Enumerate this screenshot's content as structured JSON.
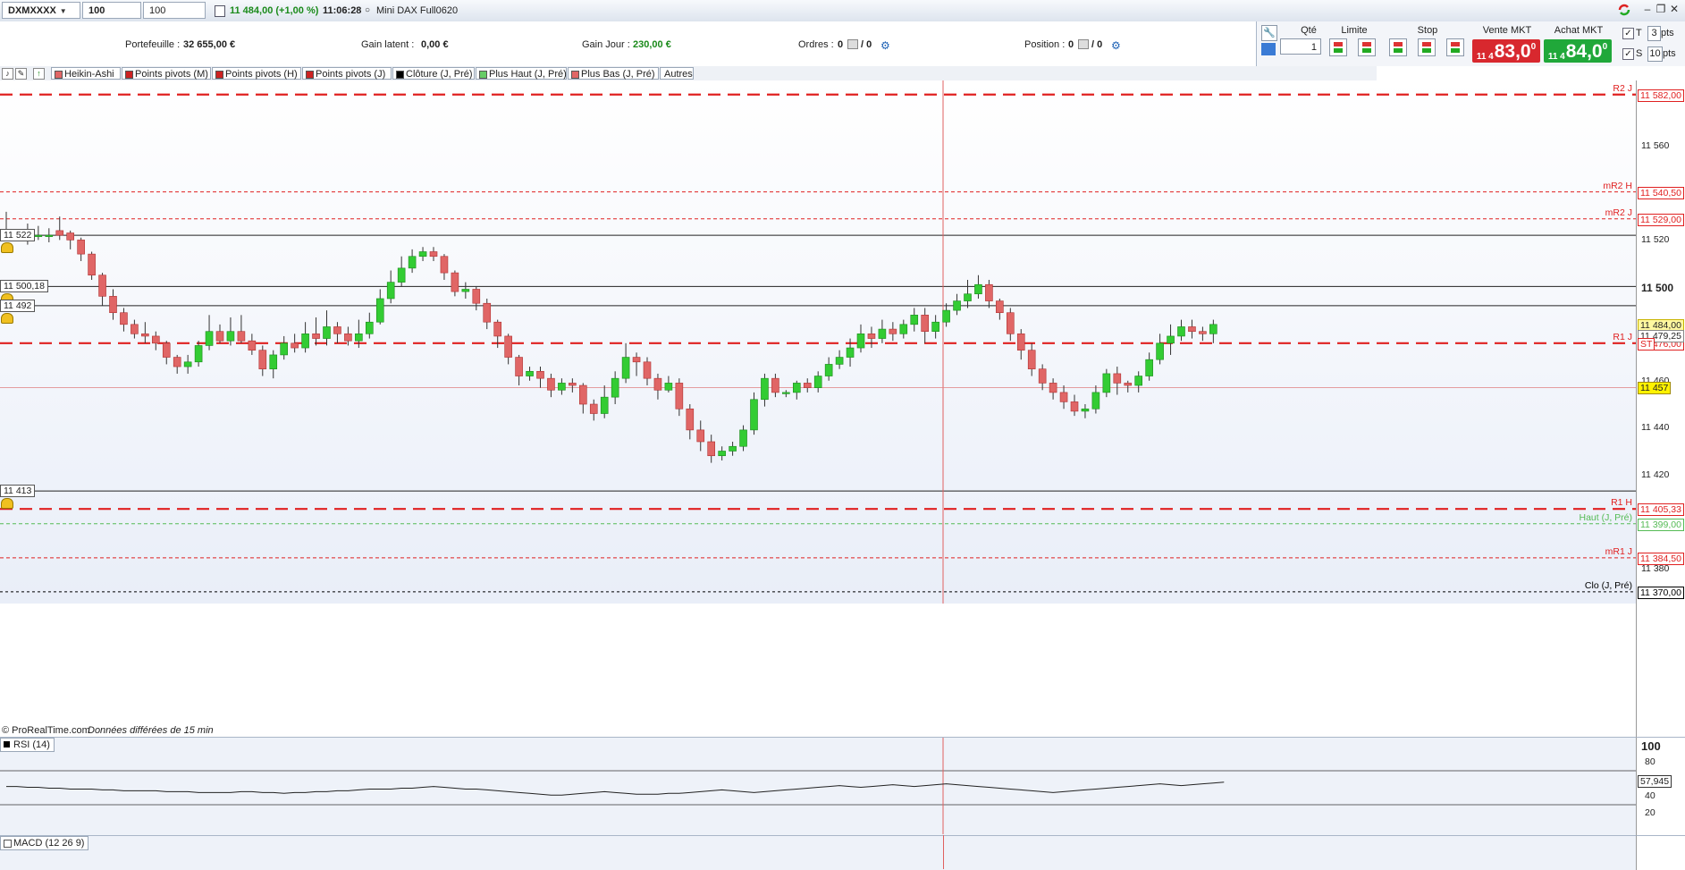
{
  "toolbar": {
    "instrument": "DXMXXXX",
    "interval": "100 ticks",
    "units": "100 unités",
    "price": "11 484,00 (+1,00 %)",
    "time": "11:06:28",
    "name": "Mini DAX Full0620"
  },
  "stats": {
    "portefeuille_label": "Portefeuille :",
    "portefeuille_value": "32 655,00 €",
    "gain_latent_label": "Gain latent :",
    "gain_latent_value": "0,00 €",
    "gain_jour_label": "Gain Jour :",
    "gain_jour_value": "230,00 €",
    "ordres_label": "Ordres :",
    "ordres_a": "0",
    "ordres_b": "/ 0",
    "position_label": "Position :",
    "position_a": "0",
    "position_b": "/ 0"
  },
  "order_panel": {
    "qty_label": "Qté",
    "qty_value": "1",
    "limit_label": "Limite",
    "stop_label": "Stop",
    "sell_label": "Vente MKT",
    "buy_label": "Achat MKT",
    "sell_small": "11 4",
    "sell_big": "83,0",
    "sell_sup": "0",
    "buy_small": "11 4",
    "buy_big": "84,0",
    "buy_sup": "0",
    "t_label": "T",
    "t_value": "3",
    "t_unit": "pts",
    "s_label": "S",
    "s_value": "10",
    "s_unit": "pts"
  },
  "indicators": [
    {
      "label": "Heikin-Ashi",
      "color": "#e06666"
    },
    {
      "label": "Points pivots (M)",
      "color": "#cc2222"
    },
    {
      "label": "Points pivots (H)",
      "color": "#cc2222"
    },
    {
      "label": "Points pivots (J)",
      "color": "#cc2222"
    },
    {
      "label": "Clôture (J, Pré)",
      "color": "#000000"
    },
    {
      "label": "Plus Haut (J, Pré)",
      "color": "#66cc66"
    },
    {
      "label": "Plus Bas (J, Pré)",
      "color": "#e06666"
    },
    {
      "label": "Autres",
      "color": ""
    }
  ],
  "chart_data": {
    "type": "candlestick",
    "ylim": [
      11365,
      11588
    ],
    "y_ticks": [
      "11 560",
      "11 520",
      "11 500",
      "11 460",
      "11 440",
      "11 420",
      "11 380"
    ],
    "levels": [
      {
        "name": "R2 J",
        "value": "11 582,00",
        "color": "#e02020"
      },
      {
        "name": "mR2 H",
        "value": "11 540,50",
        "color": "#e02020"
      },
      {
        "name": "mR2 J",
        "value": "11 529,00",
        "color": "#e02020"
      },
      {
        "name": "R1 J",
        "value": "11 476,00",
        "color": "#e02020"
      },
      {
        "name": "R1 H",
        "value": "11 405,33",
        "color": "#e02020"
      },
      {
        "name": "Haut (J, Pré)",
        "value": "11 399,00",
        "color": "#55bb55"
      },
      {
        "name": "mR1 J",
        "value": "11 384,50",
        "color": "#e02020"
      },
      {
        "name": "Clo (J, Pré)",
        "value": "11 370,00",
        "color": "#000000"
      }
    ],
    "price_tags": {
      "last": "11 484,00",
      "mid": "11 479,25",
      "st": "ST",
      "cursor": "11 457"
    },
    "alert_lines": [
      "11 522",
      "11 500,18",
      "11 492",
      "11 413"
    ],
    "candles": [
      [
        11523,
        11523,
        11523,
        11532
      ],
      [
        11522,
        11522,
        11522,
        11523
      ],
      [
        11521,
        11523,
        11518,
        11527
      ],
      [
        11522,
        11522,
        11520,
        11526
      ],
      [
        11522,
        11522,
        11519,
        11525
      ],
      [
        11524,
        11522,
        11520,
        11530
      ],
      [
        11523,
        11520,
        11516,
        11524
      ],
      [
        11520,
        11514,
        11511,
        11521
      ],
      [
        11514,
        11505,
        11503,
        11515
      ],
      [
        11505,
        11496,
        11492,
        11506
      ],
      [
        11496,
        11489,
        11486,
        11499
      ],
      [
        11489,
        11484,
        11481,
        11491
      ],
      [
        11484,
        11480,
        11478,
        11486
      ],
      [
        11480,
        11479,
        11476,
        11485
      ],
      [
        11479,
        11476,
        11473,
        11481
      ],
      [
        11476,
        11470,
        11467,
        11477
      ],
      [
        11470,
        11466,
        11463,
        11471
      ],
      [
        11466,
        11468,
        11463,
        11471
      ],
      [
        11468,
        11475,
        11466,
        11477
      ],
      [
        11475,
        11481,
        11473,
        11488
      ],
      [
        11481,
        11477,
        11476,
        11484
      ],
      [
        11477,
        11481,
        11475,
        11487
      ],
      [
        11481,
        11477,
        11476,
        11488
      ],
      [
        11477,
        11473,
        11471,
        11480
      ],
      [
        11473,
        11465,
        11462,
        11475
      ],
      [
        11465,
        11471,
        11461,
        11473
      ],
      [
        11471,
        11476,
        11469,
        11479
      ],
      [
        11476,
        11474,
        11472,
        11480
      ],
      [
        11474,
        11480,
        11472,
        11485
      ],
      [
        11480,
        11478,
        11475,
        11487
      ],
      [
        11478,
        11483,
        11475,
        11490
      ],
      [
        11483,
        11480,
        11476,
        11485
      ],
      [
        11480,
        11477,
        11475,
        11483
      ],
      [
        11477,
        11480,
        11474,
        11486
      ],
      [
        11480,
        11485,
        11478,
        11489
      ],
      [
        11485,
        11495,
        11484,
        11499
      ],
      [
        11495,
        11502,
        11493,
        11507
      ],
      [
        11502,
        11508,
        11500,
        11513
      ],
      [
        11508,
        11513,
        11506,
        11516
      ],
      [
        11513,
        11515,
        11511,
        11517
      ],
      [
        11515,
        11513,
        11511,
        11517
      ],
      [
        11513,
        11506,
        11503,
        11514
      ],
      [
        11506,
        11498,
        11496,
        11507
      ],
      [
        11498,
        11499,
        11495,
        11502
      ],
      [
        11499,
        11493,
        11490,
        11500
      ],
      [
        11493,
        11485,
        11482,
        11495
      ],
      [
        11485,
        11479,
        11474,
        11486
      ],
      [
        11479,
        11470,
        11467,
        11480
      ],
      [
        11470,
        11462,
        11458,
        11471
      ],
      [
        11462,
        11464,
        11460,
        11466
      ],
      [
        11464,
        11461,
        11457,
        11466
      ],
      [
        11461,
        11456,
        11453,
        11463
      ],
      [
        11456,
        11459,
        11454,
        11461
      ],
      [
        11459,
        11458,
        11455,
        11461
      ],
      [
        11458,
        11450,
        11446,
        11459
      ],
      [
        11450,
        11446,
        11443,
        11452
      ],
      [
        11446,
        11453,
        11444,
        11458
      ],
      [
        11453,
        11461,
        11450,
        11464
      ],
      [
        11461,
        11470,
        11459,
        11476
      ],
      [
        11470,
        11468,
        11462,
        11472
      ],
      [
        11468,
        11461,
        11458,
        11470
      ],
      [
        11461,
        11456,
        11452,
        11463
      ],
      [
        11456,
        11459,
        11455,
        11462
      ],
      [
        11459,
        11448,
        11445,
        11461
      ],
      [
        11448,
        11439,
        11435,
        11450
      ],
      [
        11439,
        11434,
        11430,
        11443
      ],
      [
        11434,
        11428,
        11425,
        11437
      ],
      [
        11428,
        11430,
        11426,
        11432
      ],
      [
        11430,
        11432,
        11428,
        11434
      ],
      [
        11432,
        11439,
        11430,
        11441
      ],
      [
        11439,
        11452,
        11437,
        11455
      ],
      [
        11452,
        11461,
        11449,
        11463
      ],
      [
        11461,
        11455,
        11453,
        11463
      ],
      [
        11455,
        11455,
        11453,
        11456
      ],
      [
        11455,
        11459,
        11452,
        11460
      ],
      [
        11459,
        11457,
        11455,
        11461
      ],
      [
        11457,
        11462,
        11455,
        11464
      ],
      [
        11462,
        11467,
        11460,
        11470
      ],
      [
        11467,
        11470,
        11465,
        11473
      ],
      [
        11470,
        11474,
        11466,
        11478
      ],
      [
        11474,
        11480,
        11472,
        11484
      ],
      [
        11480,
        11478,
        11474,
        11483
      ],
      [
        11478,
        11482,
        11476,
        11486
      ],
      [
        11482,
        11480,
        11477,
        11485
      ],
      [
        11480,
        11484,
        11478,
        11486
      ],
      [
        11484,
        11488,
        11481,
        11491
      ],
      [
        11488,
        11481,
        11476,
        11491
      ],
      [
        11481,
        11485,
        11478,
        11488
      ],
      [
        11485,
        11490,
        11483,
        11493
      ],
      [
        11490,
        11494,
        11488,
        11497
      ],
      [
        11494,
        11497,
        11491,
        11503
      ],
      [
        11497,
        11501,
        11495,
        11505
      ],
      [
        11501,
        11494,
        11491,
        11503
      ],
      [
        11494,
        11489,
        11486,
        11495
      ],
      [
        11489,
        11480,
        11477,
        11491
      ],
      [
        11480,
        11473,
        11469,
        11482
      ],
      [
        11473,
        11465,
        11462,
        11476
      ],
      [
        11465,
        11459,
        11456,
        11467
      ],
      [
        11459,
        11455,
        11452,
        11461
      ],
      [
        11455,
        11451,
        11448,
        11458
      ],
      [
        11451,
        11447,
        11445,
        11454
      ],
      [
        11447,
        11448,
        11444,
        11450
      ],
      [
        11448,
        11455,
        11446,
        11458
      ],
      [
        11455,
        11463,
        11453,
        11465
      ],
      [
        11463,
        11459,
        11454,
        11466
      ],
      [
        11459,
        11458,
        11455,
        11460
      ],
      [
        11458,
        11462,
        11455,
        11464
      ],
      [
        11462,
        11469,
        11460,
        11472
      ],
      [
        11469,
        11476,
        11467,
        11480
      ],
      [
        11476,
        11479,
        11471,
        11484
      ],
      [
        11479,
        11483,
        11477,
        11486
      ],
      [
        11483,
        11481,
        11478,
        11486
      ],
      [
        11481,
        11480,
        11477,
        11483
      ],
      [
        11480,
        11484,
        11476,
        11486
      ]
    ]
  },
  "cursor_line_value": 11457,
  "footer_note_source": "© ProRealTime.com",
  "footer_note_delay": "Données différées de 15 min",
  "rsi": {
    "label": "RSI (14)",
    "ticks": [
      "100",
      "80",
      "40",
      "20"
    ],
    "value": "57,945",
    "values": [
      52,
      52,
      51,
      51,
      50,
      50,
      49,
      49,
      49,
      48,
      48,
      47,
      47,
      47,
      47,
      46,
      46,
      46,
      45,
      45,
      45,
      45,
      46,
      46,
      45,
      45,
      44,
      45,
      45,
      46,
      46,
      47,
      47,
      48,
      49,
      49,
      49,
      50,
      50,
      51,
      52,
      51,
      50,
      49,
      49,
      48,
      47,
      46,
      45,
      44,
      43,
      42,
      42,
      43,
      44,
      45,
      46,
      45,
      44,
      43,
      43,
      43,
      44,
      44,
      45,
      46,
      47,
      48,
      47,
      46,
      45,
      46,
      47,
      48,
      49,
      50,
      51,
      52,
      53,
      52,
      51,
      52,
      53,
      54,
      53,
      52,
      53,
      54,
      55,
      54,
      53,
      52,
      51,
      50,
      49,
      48,
      47,
      46,
      45,
      46,
      47,
      48,
      49,
      50,
      51,
      52,
      53,
      54,
      55,
      54,
      53,
      54,
      55,
      56,
      57
    ]
  },
  "macd": {
    "label": "MACD (12 26 9)"
  }
}
